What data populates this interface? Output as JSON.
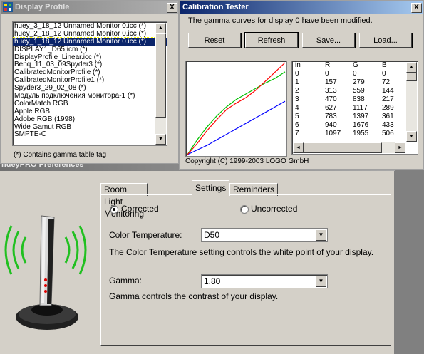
{
  "display_profile": {
    "title": "Display Profile",
    "profiles": [
      "huey_3_18_12 Unnamed Monitor 0.icc (*)",
      "huey_2_18_12 Unnamed Monitor 0.icc (*)",
      "huey_1_18_12 Unnamed Monitor 0.icc (*)",
      "DISPLAY1_D65.icm (*)",
      "DisplayProfile_Linear.icc (*)",
      "Benq_11_03_09Spyder3 (*)",
      "CalibratedMonitorProfile (*)",
      "CalibratedMonitorProfile1 (*)",
      "Spyder3_29_02_08 (*)",
      "Модуль подключения монитора-1 (*)",
      "ColorMatch RGB",
      "Apple RGB",
      "Adobe RGB (1998)",
      "Wide Gamut RGB",
      "SMPTE-C"
    ],
    "selected_index": 2,
    "footnote": "(*) Contains gamma table tag",
    "close_label": "X"
  },
  "calibration_tester": {
    "title": "Calibration Tester",
    "message": "The gamma curves for display 0 have been modified.",
    "buttons": {
      "reset": "Reset",
      "refresh": "Refresh",
      "save": "Save...",
      "load": "Load..."
    },
    "copyright": "Copyright (C) 1999-2003 LOGO GmbH",
    "close_label": "X",
    "table": {
      "headers": [
        "in",
        "R",
        "G",
        "B"
      ],
      "rows": [
        [
          "0",
          "0",
          "0",
          "0"
        ],
        [
          "1",
          "157",
          "279",
          "72"
        ],
        [
          "2",
          "313",
          "559",
          "144"
        ],
        [
          "3",
          "470",
          "838",
          "217"
        ],
        [
          "4",
          "627",
          "1117",
          "289"
        ],
        [
          "5",
          "783",
          "1397",
          "361"
        ],
        [
          "6",
          "940",
          "1676",
          "433"
        ],
        [
          "7",
          "1097",
          "1955",
          "506"
        ]
      ]
    },
    "curves": {
      "colors": {
        "red": "#ff0000",
        "green": "#00c000",
        "blue": "#0000ff"
      },
      "red": [
        [
          0,
          0
        ],
        [
          0.1,
          0.12
        ],
        [
          0.2,
          0.26
        ],
        [
          0.3,
          0.38
        ],
        [
          0.4,
          0.49
        ],
        [
          0.5,
          0.56
        ],
        [
          0.6,
          0.62
        ],
        [
          0.7,
          0.7
        ],
        [
          0.8,
          0.8
        ],
        [
          0.9,
          0.9
        ],
        [
          1,
          1
        ]
      ],
      "green": [
        [
          0,
          0
        ],
        [
          0.1,
          0.16
        ],
        [
          0.2,
          0.3
        ],
        [
          0.3,
          0.42
        ],
        [
          0.4,
          0.52
        ],
        [
          0.5,
          0.6
        ],
        [
          0.6,
          0.66
        ],
        [
          0.7,
          0.72
        ],
        [
          0.8,
          0.78
        ],
        [
          0.9,
          0.83
        ],
        [
          1,
          0.9
        ]
      ],
      "blue": [
        [
          0,
          0
        ],
        [
          0.1,
          0.05
        ],
        [
          0.2,
          0.1
        ],
        [
          0.3,
          0.16
        ],
        [
          0.4,
          0.22
        ],
        [
          0.5,
          0.28
        ],
        [
          0.6,
          0.34
        ],
        [
          0.7,
          0.4
        ],
        [
          0.8,
          0.46
        ],
        [
          0.9,
          0.52
        ],
        [
          1,
          0.58
        ]
      ]
    }
  },
  "huey_prefs": {
    "title": "hueyPRO Preferences",
    "tabs": [
      "Room Light Monitoring",
      "Settings",
      "Reminders"
    ],
    "active_tab": 1,
    "mode": {
      "corrected": "Corrected",
      "uncorrected": "Uncorrected",
      "selected": "corrected"
    },
    "color_temperature": {
      "label": "Color Temperature:",
      "value": "D50",
      "description": "The Color Temperature setting controls the white point of your display."
    },
    "gamma": {
      "label": "Gamma:",
      "value": "1.80",
      "description": "Gamma controls the contrast of your display."
    }
  }
}
